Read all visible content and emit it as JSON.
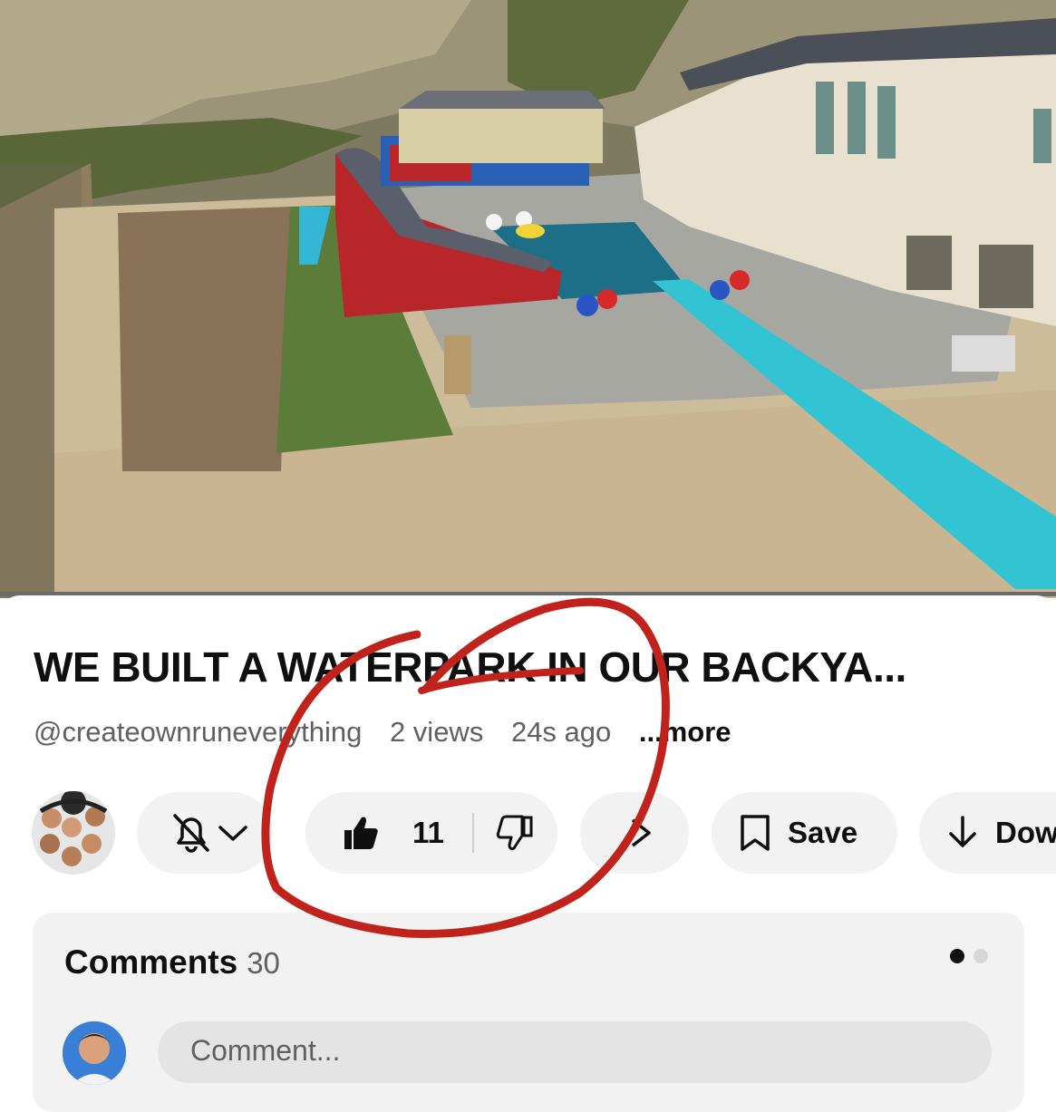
{
  "video": {
    "thumbnail_description": "aerial-backyard-waterpark-scene"
  },
  "title": "WE BUILT A WATERPARK IN OUR BACKYA...",
  "meta": {
    "channel_handle": "@createownruneverything",
    "views": "2 views",
    "age": "24s ago",
    "more": "...more"
  },
  "actions": {
    "like_count": "11",
    "save_label": "Save",
    "download_label": "Dow"
  },
  "comments": {
    "heading": "Comments",
    "count": "30",
    "placeholder": "Comment..."
  },
  "icons": {
    "bell": "bell-off-icon",
    "chevron": "chevron-down-icon",
    "like": "thumbs-up-icon",
    "dislike": "thumbs-down-icon",
    "share": "share-icon",
    "save": "bookmark-icon",
    "download": "download-icon"
  },
  "colors": {
    "annotation": "#c0231c",
    "pill_bg": "#f2f2f2",
    "meta_text": "#606060"
  }
}
